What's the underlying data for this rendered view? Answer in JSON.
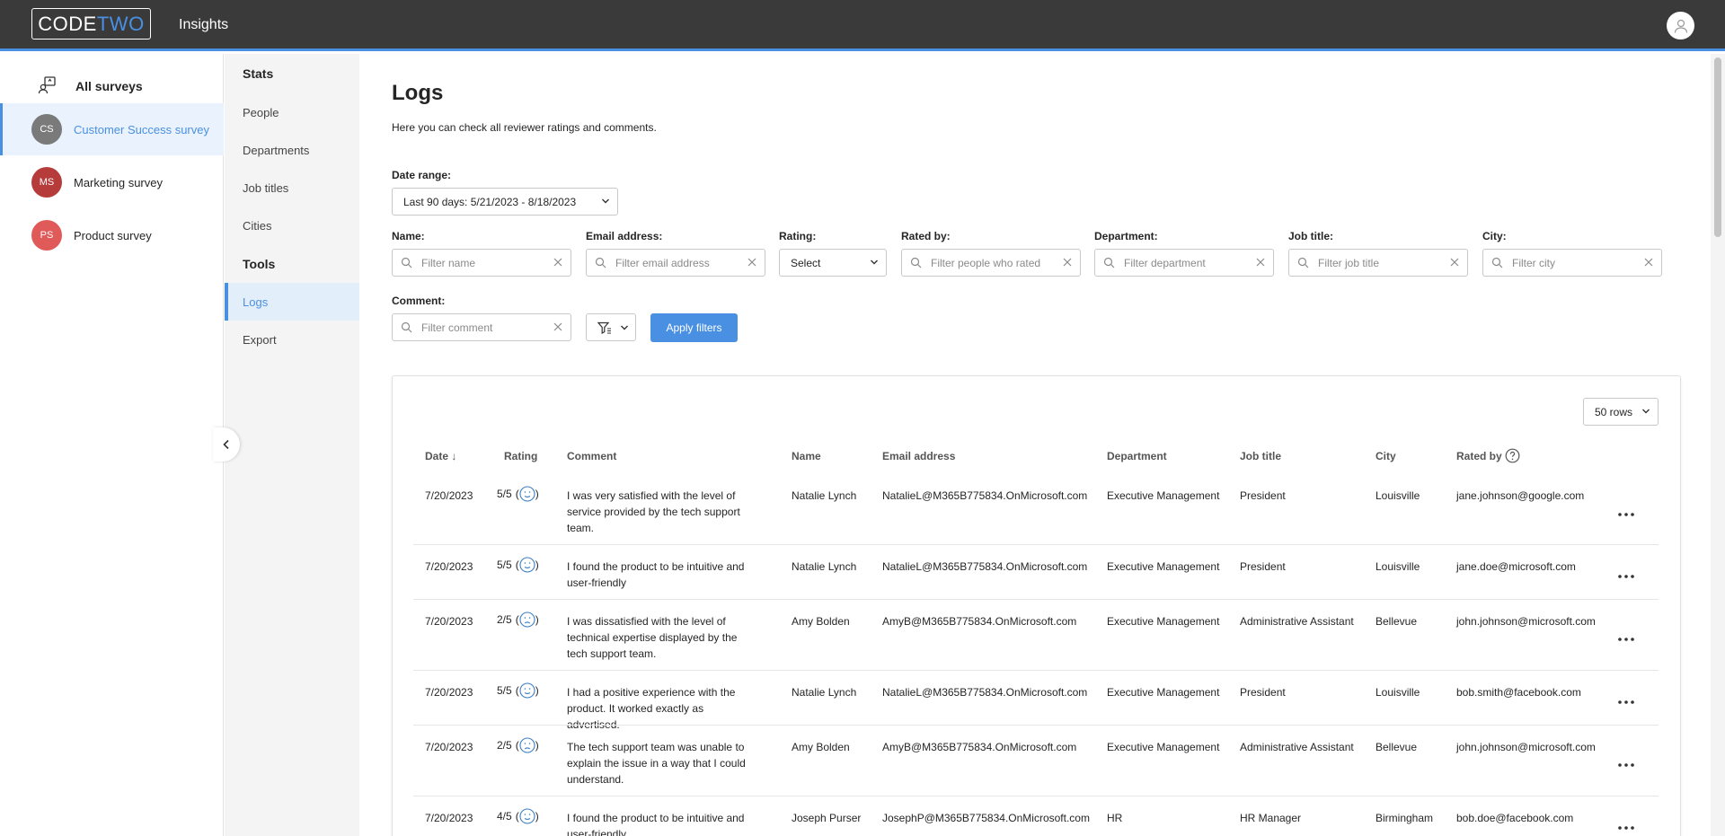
{
  "app": {
    "logo_code": "CODE",
    "logo_two": "TWO",
    "title": "Insights"
  },
  "colors": {
    "accent": "#4a90e2",
    "topbar": "#3a3a3a",
    "cs": "#7a7a7a",
    "ms": "#b63c3c",
    "ps": "#e05a5a"
  },
  "sidebar": {
    "all_surveys": "All surveys",
    "surveys": [
      {
        "initials": "CS",
        "name": "Customer Success survey",
        "active": true
      },
      {
        "initials": "MS",
        "name": "Marketing survey"
      },
      {
        "initials": "PS",
        "name": "Product survey"
      }
    ]
  },
  "nav": {
    "stats_heading": "Stats",
    "stats_items": [
      "People",
      "Departments",
      "Job titles",
      "Cities"
    ],
    "tools_heading": "Tools",
    "tools_items": [
      "Logs",
      "Export"
    ]
  },
  "page": {
    "title": "Logs",
    "subtitle": "Here you can check all reviewer ratings and comments."
  },
  "filters": {
    "date_range_label": "Date range:",
    "date_range_value": "Last 90 days: 5/21/2023 - 8/18/2023",
    "name_label": "Name:",
    "name_ph": "Filter name",
    "email_label": "Email address:",
    "email_ph": "Filter email address",
    "rating_label": "Rating:",
    "rating_value": "Select",
    "rated_by_label": "Rated by:",
    "rated_by_ph": "Filter people who rated",
    "department_label": "Department:",
    "department_ph": "Filter department",
    "job_title_label": "Job title:",
    "job_title_ph": "Filter job title",
    "city_label": "City:",
    "city_ph": "Filter city",
    "comment_label": "Comment:",
    "comment_ph": "Filter comment",
    "apply_label": "Apply filters"
  },
  "table": {
    "rows_select": "50 rows",
    "headers": {
      "date": "Date ↓",
      "rating": "Rating",
      "comment": "Comment",
      "name": "Name",
      "email": "Email address",
      "department": "Department",
      "job_title": "Job title",
      "city": "City",
      "rated_by": "Rated by"
    },
    "rows": [
      {
        "date": "7/20/2023",
        "rating": "5/5",
        "mood": "happy",
        "comment": "I was very satisfied with the level of service provided by the tech support team.",
        "name": "Natalie Lynch",
        "email": "NatalieL@M365B775834.OnMicrosoft.com",
        "department": "Executive Management",
        "job_title": "President",
        "city": "Louisville",
        "rated_by": "jane.johnson@google.com"
      },
      {
        "date": "7/20/2023",
        "rating": "5/5",
        "mood": "happy",
        "comment": "I found the product to be intuitive and user-friendly",
        "name": "Natalie Lynch",
        "email": "NatalieL@M365B775834.OnMicrosoft.com",
        "department": "Executive Management",
        "job_title": "President",
        "city": "Louisville",
        "rated_by": "jane.doe@microsoft.com"
      },
      {
        "date": "7/20/2023",
        "rating": "2/5",
        "mood": "sad",
        "comment": "I was dissatisfied with the level of technical expertise displayed by the tech support team.",
        "name": "Amy Bolden",
        "email": "AmyB@M365B775834.OnMicrosoft.com",
        "department": "Executive Management",
        "job_title": "Administrative Assistant",
        "city": "Bellevue",
        "rated_by": "john.johnson@microsoft.com"
      },
      {
        "date": "7/20/2023",
        "rating": "5/5",
        "mood": "happy",
        "comment": "I had a positive experience with the product. It worked exactly as advertised.",
        "name": "Natalie Lynch",
        "email": "NatalieL@M365B775834.OnMicrosoft.com",
        "department": "Executive Management",
        "job_title": "President",
        "city": "Louisville",
        "rated_by": "bob.smith@facebook.com"
      },
      {
        "date": "7/20/2023",
        "rating": "2/5",
        "mood": "sad",
        "comment": "The tech support team was unable to explain the issue in a way that I could understand.",
        "name": "Amy Bolden",
        "email": "AmyB@M365B775834.OnMicrosoft.com",
        "department": "Executive Management",
        "job_title": "Administrative Assistant",
        "city": "Bellevue",
        "rated_by": "john.johnson@microsoft.com"
      },
      {
        "date": "7/20/2023",
        "rating": "4/5",
        "mood": "happy",
        "comment": "I found the product to be intuitive and user-friendly",
        "name": "Joseph Purser",
        "email": "JosephP@M365B775834.OnMicrosoft.com",
        "department": "HR",
        "job_title": "HR Manager",
        "city": "Birmingham",
        "rated_by": "bob.doe@facebook.com"
      }
    ]
  }
}
